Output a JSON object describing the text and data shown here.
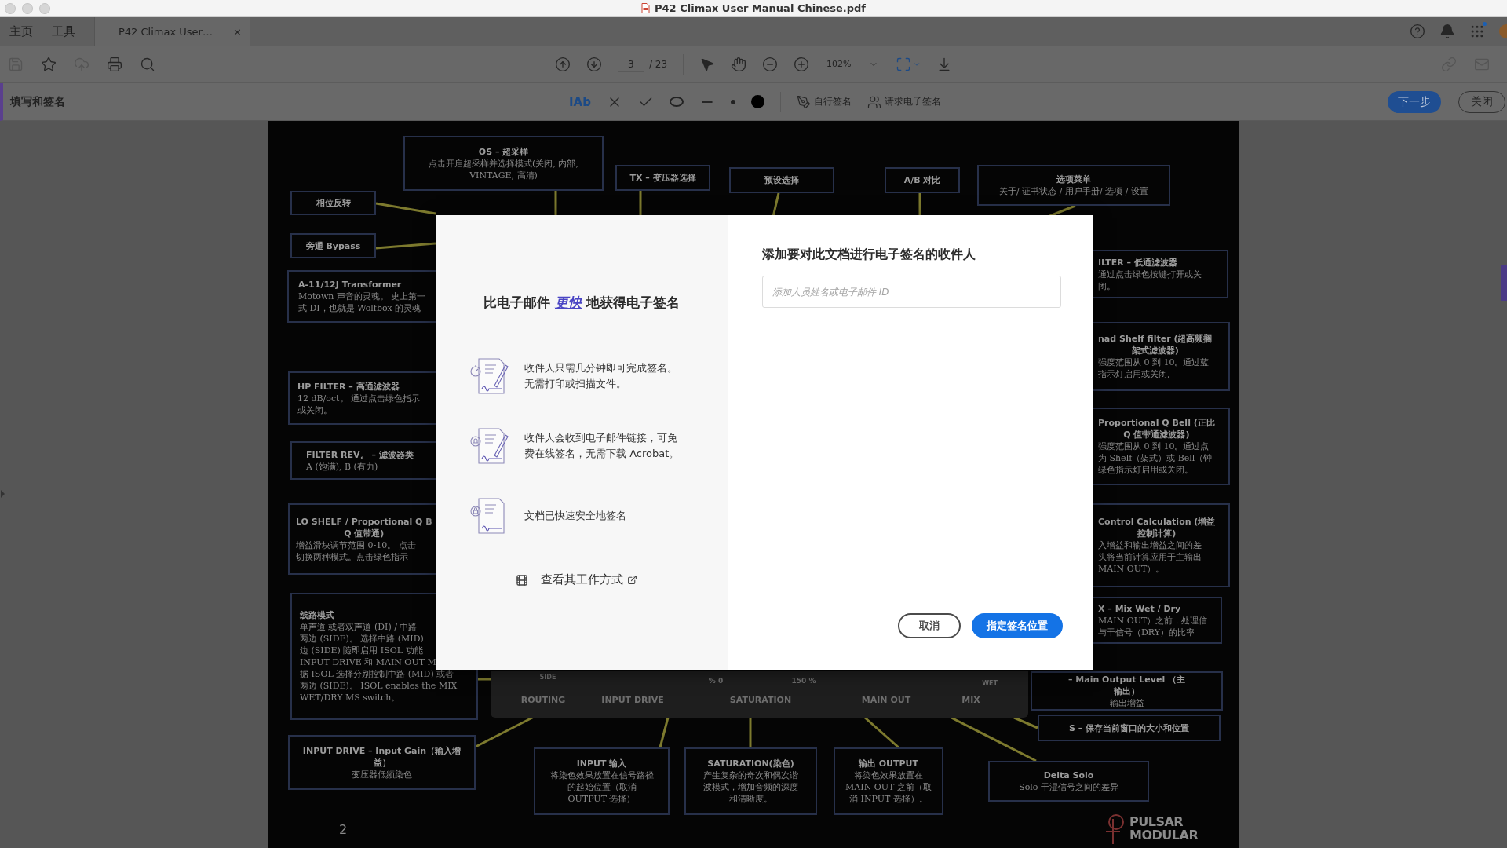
{
  "window": {
    "title": "P42 Climax User Manual Chinese.pdf"
  },
  "nav_tabs": [
    {
      "label": "主页",
      "selected": false
    },
    {
      "label": "工具",
      "selected": false
    },
    {
      "label": "P42 Climax User…",
      "selected": true,
      "close": "×"
    }
  ],
  "toolbar": {
    "page_number": "3",
    "page_count": "/ 23",
    "zoom": "102%"
  },
  "sign_bar": {
    "title": "填写和签名",
    "tools": [
      {
        "kind": "text",
        "label": "IAb"
      },
      {
        "kind": "cross"
      },
      {
        "kind": "check"
      },
      {
        "kind": "ellipse"
      },
      {
        "kind": "line"
      },
      {
        "kind": "dot"
      },
      {
        "kind": "disc"
      }
    ],
    "actions": [
      {
        "kind": "self",
        "label": "自行签名"
      },
      {
        "kind": "request",
        "label": "请求电子签名"
      }
    ],
    "next": "下一步",
    "close": "关闭"
  },
  "pdf_page": {
    "callouts": [
      {
        "title": [
          "OS – 超采样"
        ],
        "body": [
          "点击开启超采样并选择模式(关闭, 内部,",
          "VINTAGE, 高清)"
        ]
      },
      {
        "title": [
          "TX – 变压器选择"
        ]
      },
      {
        "title": [
          "预设选择"
        ]
      },
      {
        "title": [
          "A/B 对比"
        ]
      },
      {
        "title": [
          "选项菜单"
        ],
        "body": [
          "关于/ 证书状态 / 用户手册/ 选项 / 设置"
        ]
      },
      {
        "title": [
          "相位反转"
        ]
      },
      {
        "title": [
          "旁通 Bypass"
        ]
      },
      {
        "title": [
          "A-11/12J Transformer"
        ],
        "body": [
          "Motown 声音的灵魂。 史上第一",
          "式 DI，也就是 Wolfbox 的灵魂"
        ]
      },
      {
        "title": [
          "ILTER – 低通滤波器"
        ],
        "body": [
          "通过点击绿色按键打开或关",
          "闭。"
        ]
      },
      {
        "title": [
          "HP FILTER – 高通滤波器"
        ],
        "body": [
          "12 dB/oct。 通过点击绿色指示",
          "或关闭。"
        ]
      },
      {
        "title": [
          "nad Shelf filter (超高频搁",
          "架式滤波器)"
        ],
        "body": [
          "强度范围从 0 到 10。通过蓝",
          "指示灯启用或关闭,"
        ]
      },
      {
        "title": [
          "FILTER REV。 – 滤波器类"
        ],
        "body": [
          "A (饱满), B (有力)"
        ]
      },
      {
        "title": [
          "Proportional Q Bell (正比",
          "Q 值带通滤波器)"
        ],
        "body": [
          "强度范围从 0 到 10。通过点",
          "为 Shelf（架式）或 Bell（钟",
          "绿色指示灯启用或关闭。"
        ]
      },
      {
        "title": [
          "LO SHELF / Proportional Q B",
          "Q 值带通)"
        ],
        "body": [
          "增益滑块调节范围 0-10。 点击",
          "切换两种模式。点击绿色指示"
        ]
      },
      {
        "title": [
          "Control Calculation (增益",
          "控制计算)"
        ],
        "body": [
          "入增益和输出增益之间的差",
          "头将当前计算应用于主输出",
          "MAIN OUT）。"
        ]
      },
      {
        "title": [
          "线路模式"
        ],
        "body": [
          "单声道 或者双声道 (DI) / 中路",
          "两边 (SIDE)。 选择中路 (MID)",
          "边 (SIDE) 随即启用 ISOL 功能",
          "INPUT DRIVE 和 MAIN OUT M",
          "据 ISOL 选择分别控制中路 (MID) 或者",
          "两边 (SIDE)。 ISOL enables the MIX",
          "WET/DRY MS switch。"
        ]
      },
      {
        "title": [
          "X – Mix Wet / Dry"
        ],
        "body": [
          "MAIN OUT）之前，处理信",
          "与干信号（DRY）的比率"
        ]
      },
      {
        "title": [
          "– Main Output Level （主",
          "输出）"
        ],
        "body": [
          "输出增益"
        ]
      },
      {
        "title": [
          "S – 保存当前窗口的大小和位置"
        ]
      },
      {
        "title": [
          "INPUT DRIVE – Input Gain（输入增",
          "益）"
        ],
        "body": [
          "变压器低频染色"
        ]
      },
      {
        "title": [
          "INPUT 输入"
        ],
        "body": [
          "将染色效果放置在信号路径",
          "的起始位置（取消",
          "OUTPUT 选择）"
        ]
      },
      {
        "title": [
          "SATURATION(染色)"
        ],
        "body": [
          "产生复杂的奇次和偶次谐",
          "波模式，增加音频的深度",
          "和清晰度。"
        ]
      },
      {
        "title": [
          "输出 OUTPUT"
        ],
        "body": [
          "将染色效果放置在",
          "MAIN OUT 之前（取",
          "消 INPUT 选择）。"
        ]
      },
      {
        "title": [
          "Delta Solo"
        ],
        "body": [
          "Solo 干湿信号之间的差异"
        ]
      }
    ],
    "plugin_labels": [
      "ROUTING",
      "INPUT DRIVE",
      "SATURATION",
      "MAIN OUT",
      "MIX",
      "SIDE",
      "% 0",
      "150 %",
      "WET"
    ],
    "page_number": "2",
    "logo": [
      "PULSAR",
      "MODULAR"
    ]
  },
  "dialog": {
    "heading": {
      "before": "比电子邮件",
      "link": "更快",
      "after": "地获得电子签名"
    },
    "features": [
      {
        "kind": "timer",
        "lines": [
          "收件人只需几分钟即可完成签名。",
          "无需打印或扫描文件。"
        ]
      },
      {
        "kind": "bell",
        "lines": [
          "收件人会收到电子邮件链接，可免",
          "费在线签名，无需下载 Acrobat。"
        ]
      },
      {
        "kind": "lock",
        "lines": [
          "文档已快速安全地签名"
        ]
      }
    ],
    "how_link": "查看其工作方式",
    "title": "添加要对此文档进行电子签名的收件人",
    "recipient_placeholder": "添加人员姓名或电子邮件 ID",
    "buttons": [
      {
        "kind": "secondary",
        "label": "取消"
      },
      {
        "kind": "primary",
        "label": "指定签名位置"
      }
    ]
  }
}
